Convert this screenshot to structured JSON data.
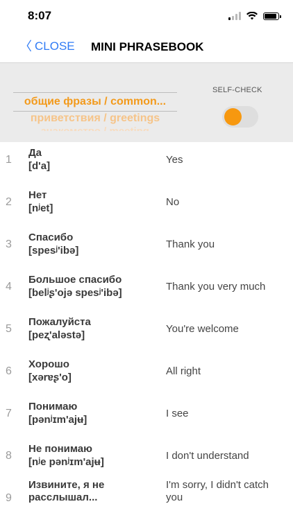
{
  "status": {
    "time": "8:07"
  },
  "nav": {
    "back_label": "CLOSE",
    "title": "MINI PHRASEBOOK"
  },
  "controls": {
    "categories": [
      "общие фразы / common...",
      "приветствия / greetings",
      "знакомство / meeting"
    ],
    "self_check_label": "SELF-CHECK",
    "self_check_on": true,
    "accent": "#f7980f"
  },
  "phrases": [
    {
      "num": "1",
      "ru": "Да",
      "tr": "[d'a]",
      "en": "Yes"
    },
    {
      "num": "2",
      "ru": "Нет",
      "tr": "[nʲet]",
      "en": "No"
    },
    {
      "num": "3",
      "ru": "Спасибо",
      "tr": "[spesʲ'ibə]",
      "en": "Thank you"
    },
    {
      "num": "4",
      "ru": "Большое спасибо",
      "tr": "[belʲʂ'ojə spesʲ'ibə]",
      "en": "Thank you very much"
    },
    {
      "num": "5",
      "ru": "Пожалуйста",
      "tr": "[peʐ'aləstə]",
      "en": "You're welcome"
    },
    {
      "num": "6",
      "ru": "Хорошо",
      "tr": "[xərɐʂ'o]",
      "en": "All right"
    },
    {
      "num": "7",
      "ru": "Понимаю",
      "tr": "[pənʲɪm'ajʉ]",
      "en": "I see"
    },
    {
      "num": "8",
      "ru": "Не понимаю",
      "tr": "[nʲe pənʲɪm'ajʉ]",
      "en": "I don't understand"
    },
    {
      "num": "9",
      "ru": "Извините, я не расслышал...",
      "tr": "",
      "en": "I'm sorry, I didn't catch you"
    }
  ]
}
